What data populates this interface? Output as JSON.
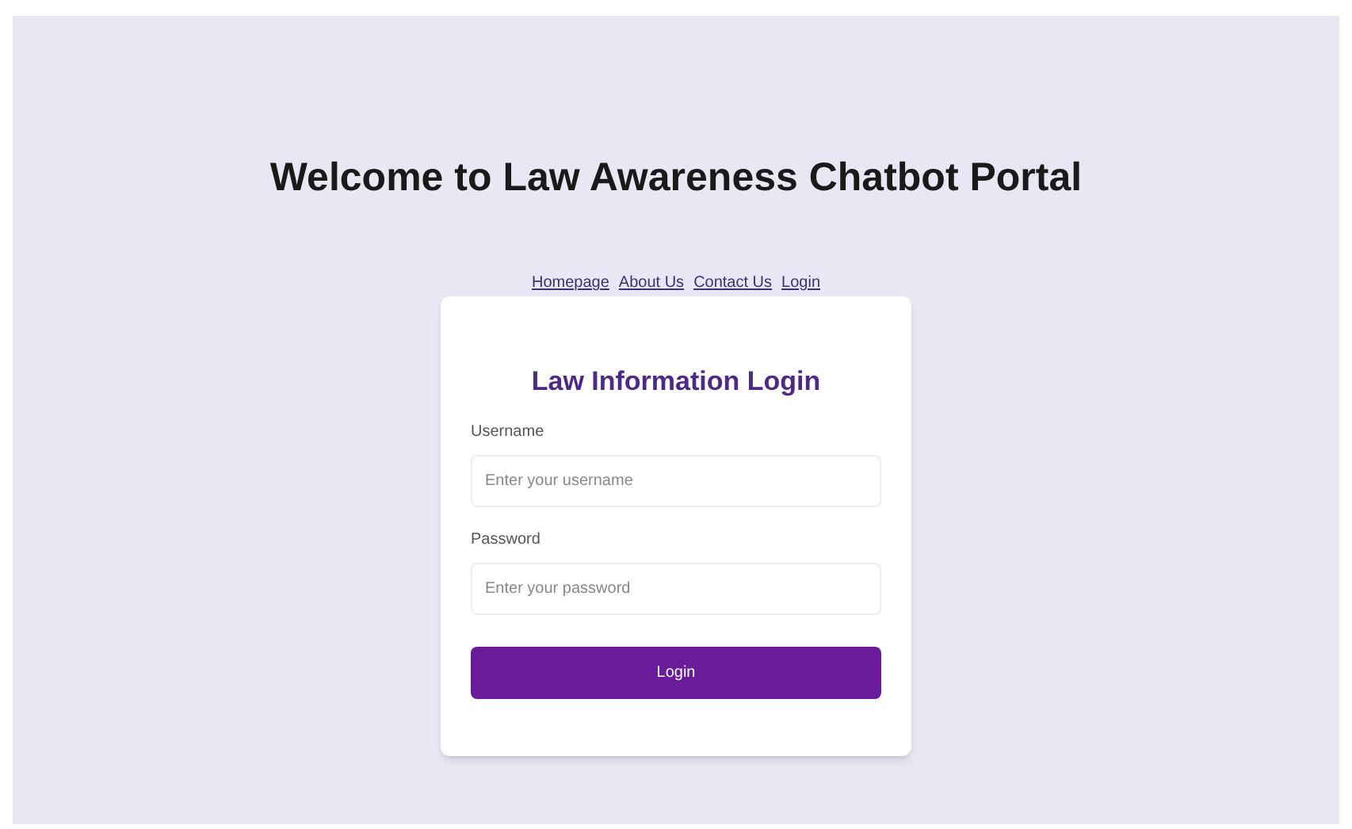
{
  "title": "Welcome to Law Awareness Chatbot Portal",
  "nav": [
    "Homepage",
    "About Us",
    "Contact Us",
    "Login"
  ],
  "card": {
    "title": "Law Information Login",
    "fields": [
      {
        "label": "Username",
        "placeholder": "Enter your username"
      },
      {
        "label": "Password",
        "placeholder": "Enter your password"
      }
    ],
    "button": "Login"
  }
}
